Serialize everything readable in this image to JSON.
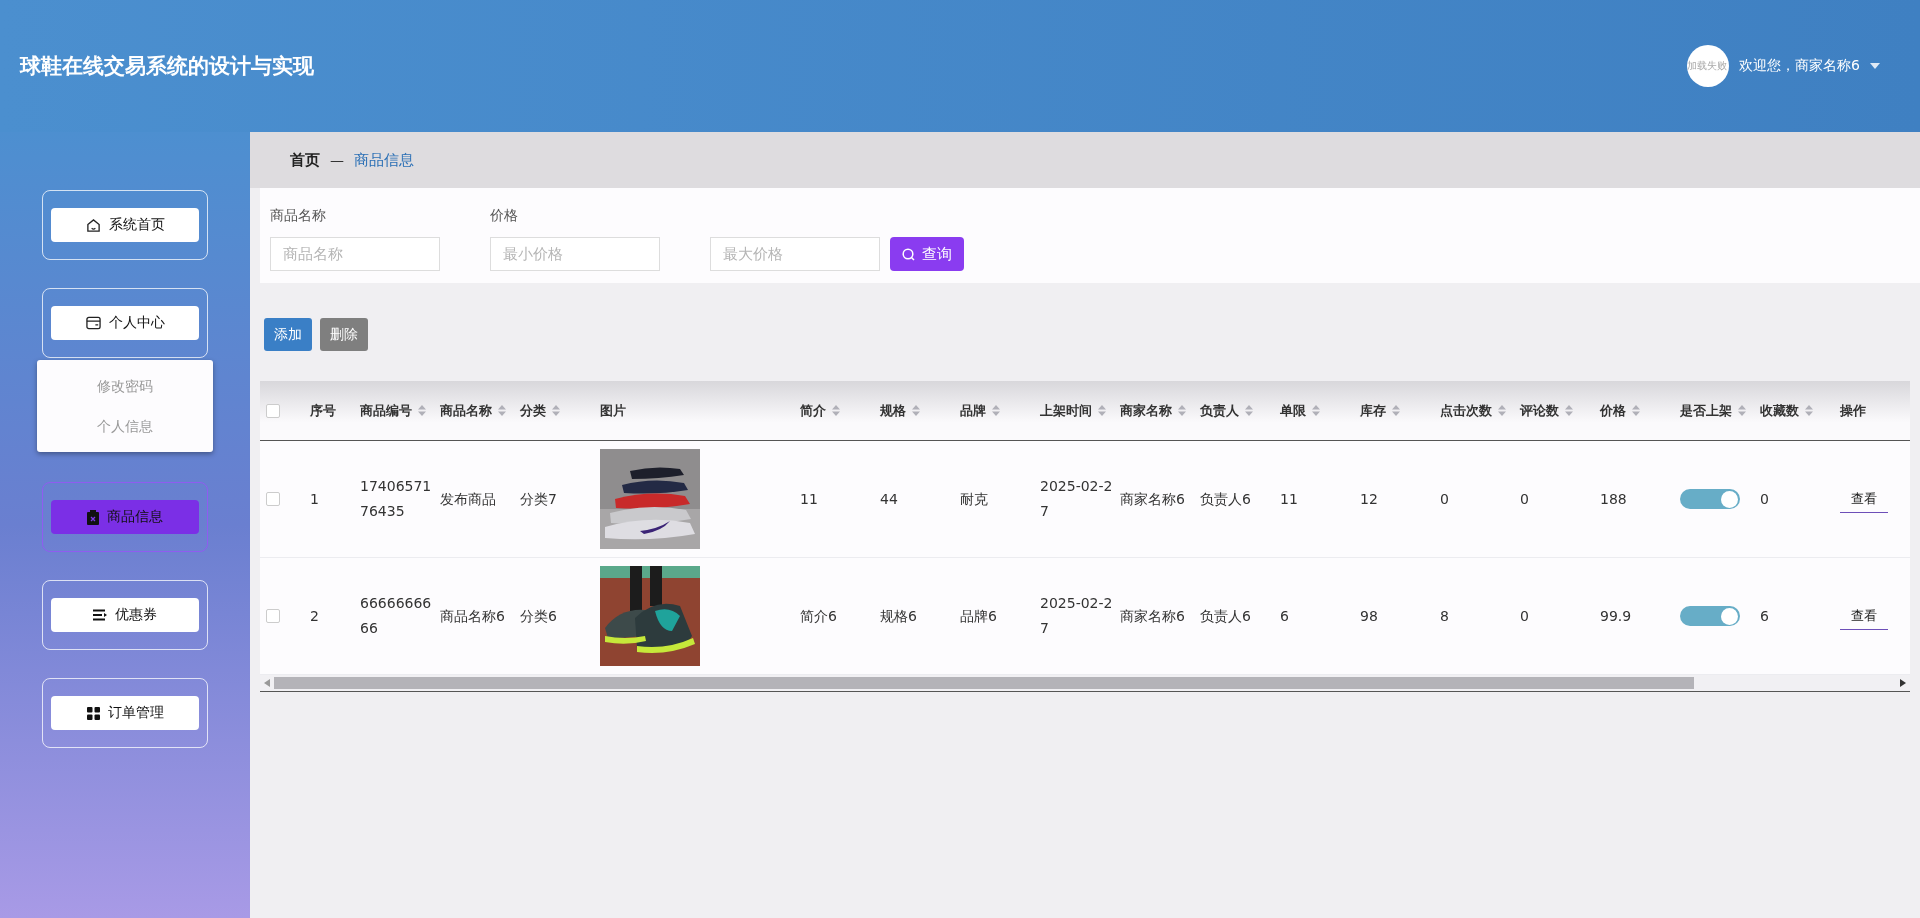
{
  "header": {
    "title": "球鞋在线交易系统的设计与实现",
    "avatar_alt": "加载失败",
    "welcome": "欢迎您，商家名称6"
  },
  "sidebar": {
    "items": [
      {
        "label": "系统首页",
        "selected": false
      },
      {
        "label": "个人中心",
        "selected": false,
        "expanded": true,
        "children": [
          {
            "label": "修改密码"
          },
          {
            "label": "个人信息"
          }
        ]
      },
      {
        "label": "商品信息",
        "selected": true
      },
      {
        "label": "优惠券",
        "selected": false
      },
      {
        "label": "订单管理",
        "selected": false
      }
    ]
  },
  "breadcrumb": {
    "home": "首页",
    "separator": "—",
    "current": "商品信息"
  },
  "search": {
    "fields": [
      {
        "label": "商品名称",
        "placeholder": "商品名称"
      },
      {
        "label": "价格",
        "placeholder": "最小价格"
      },
      {
        "placeholder": "最大价格"
      }
    ],
    "button": "查询"
  },
  "actions": [
    "添加",
    "删除"
  ],
  "table": {
    "all_checked": false,
    "columns": [
      {
        "label": "序号",
        "sortable": false
      },
      {
        "label": "商品编号",
        "sortable": true
      },
      {
        "label": "商品名称",
        "sortable": true
      },
      {
        "label": "分类",
        "sortable": true
      },
      {
        "label": "图片",
        "sortable": false
      },
      {
        "label": "简介",
        "sortable": true
      },
      {
        "label": "规格",
        "sortable": true
      },
      {
        "label": "品牌",
        "sortable": true
      },
      {
        "label": "上架时间",
        "sortable": true
      },
      {
        "label": "商家名称",
        "sortable": true
      },
      {
        "label": "负责人",
        "sortable": true
      },
      {
        "label": "单限",
        "sortable": true
      },
      {
        "label": "库存",
        "sortable": true
      },
      {
        "label": "点击次数",
        "sortable": true
      },
      {
        "label": "评论数",
        "sortable": true
      },
      {
        "label": "价格",
        "sortable": true
      },
      {
        "label": "是否上架",
        "sortable": true
      },
      {
        "label": "收藏数",
        "sortable": true
      },
      {
        "label": "操作",
        "sortable": false
      }
    ],
    "rows": [
      {
        "checked": false,
        "index": "1",
        "code": "1740657176435",
        "name": "发布商品",
        "category": "分类7",
        "intro": "11",
        "spec": "44",
        "brand": "耐克",
        "date": "2025-02-27",
        "merchant": "商家名称6",
        "owner": "负责人6",
        "limit": "11",
        "stock": "12",
        "clicks": "0",
        "comments": "0",
        "price": "188",
        "on_shelf": true,
        "favorites": "0",
        "action": "查看"
      },
      {
        "checked": false,
        "index": "2",
        "code": "6666666666",
        "name": "商品名称6",
        "category": "分类6",
        "intro": "简介6",
        "spec": "规格6",
        "brand": "品牌6",
        "date": "2025-02-27",
        "merchant": "商家名称6",
        "owner": "负责人6",
        "limit": "6",
        "stock": "98",
        "clicks": "8",
        "comments": "0",
        "price": "99.9",
        "on_shelf": true,
        "favorites": "6",
        "action": "查看"
      }
    ]
  }
}
